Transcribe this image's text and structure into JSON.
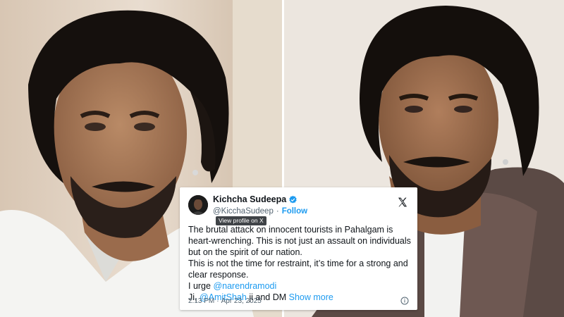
{
  "tweet": {
    "display_name": "Kichcha Sudeepa",
    "handle": "@KicchaSudeep",
    "separator": "·",
    "follow_label": "Follow",
    "tooltip": "View profile on X",
    "body_lines": [
      "The brutal attack on innocent tourists in Pahalgam is",
      "heart-wrenching. This is not just an assault on individuals",
      "but on the spirit of our nation.",
      "This is not the time for restraint, it’s time for a strong and",
      "clear response."
    ],
    "urge_prefix": "I urge ",
    "mention_1": "@narendramodi",
    "ji_prefix": "Ji, ",
    "mention_2": "@AmitShah",
    "ji_dm": " ji and DM ",
    "show_more": "Show more",
    "time": "2:13 PM",
    "date_sep": "·",
    "date": "Apr 23, 2025",
    "icons": [
      "verified-badge-icon",
      "x-logo-icon",
      "info-icon"
    ],
    "accent_color": "#1d9bf0"
  }
}
